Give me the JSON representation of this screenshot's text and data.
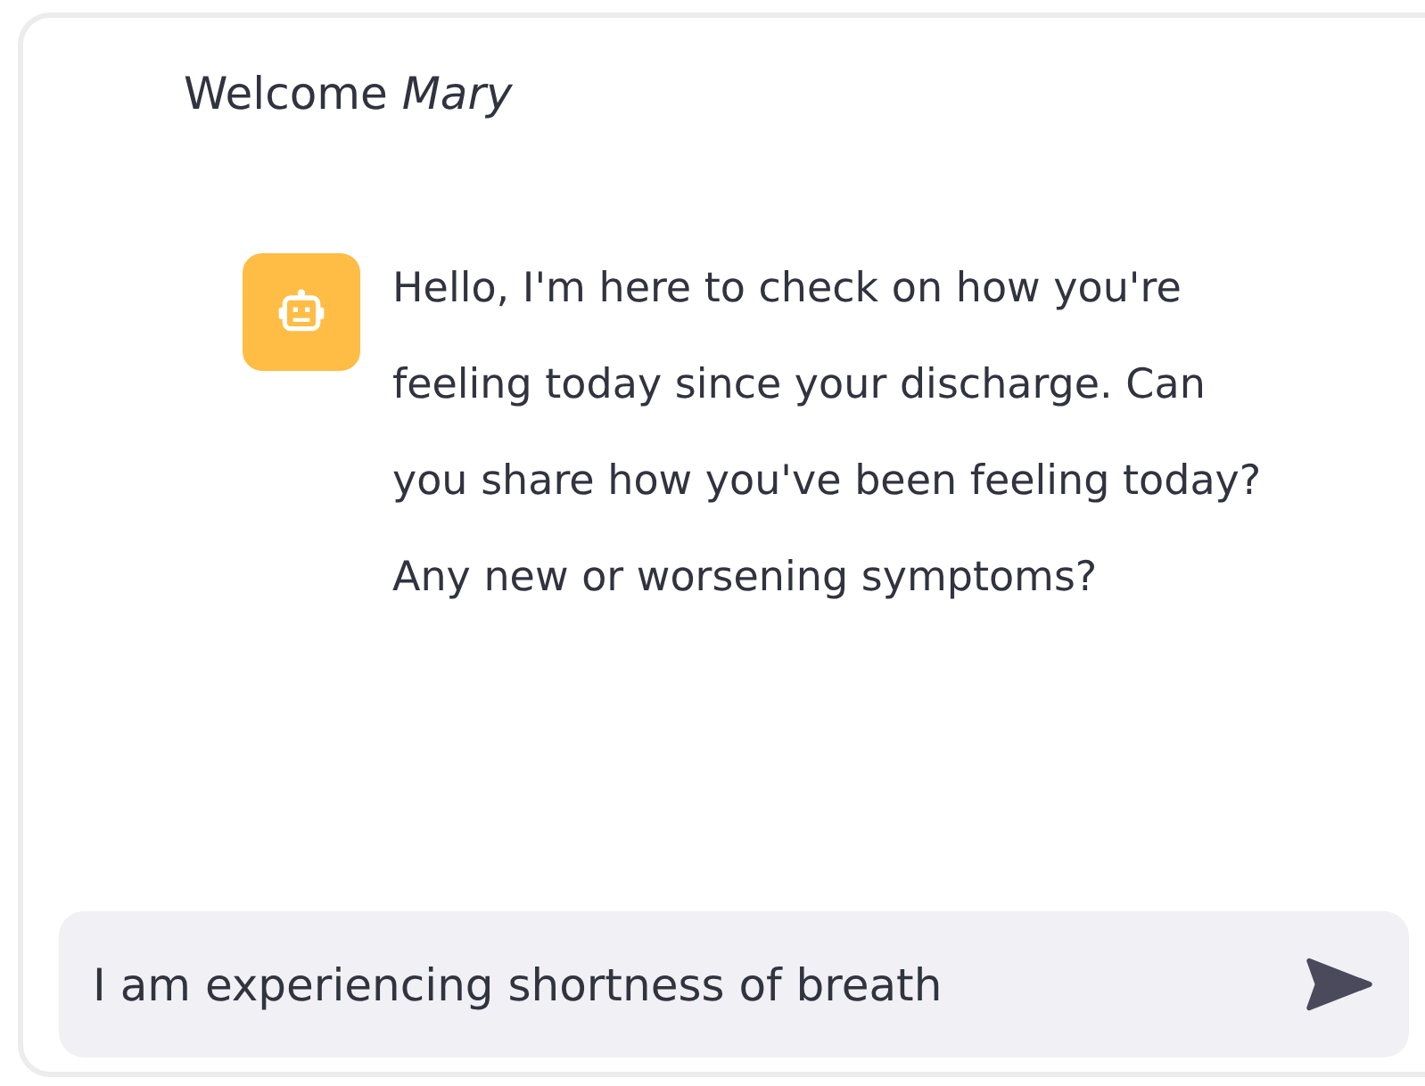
{
  "greeting": "Welcome *Mary*",
  "messages": [
    {
      "kind": "bot",
      "text": "Hello, I'm here to check on how you're feeling today since your discharge. Can you share how you've been feeling today? Any new or worsening symptoms?"
    }
  ],
  "chat_input": {
    "value": "I am experiencing shortness of breath"
  }
}
